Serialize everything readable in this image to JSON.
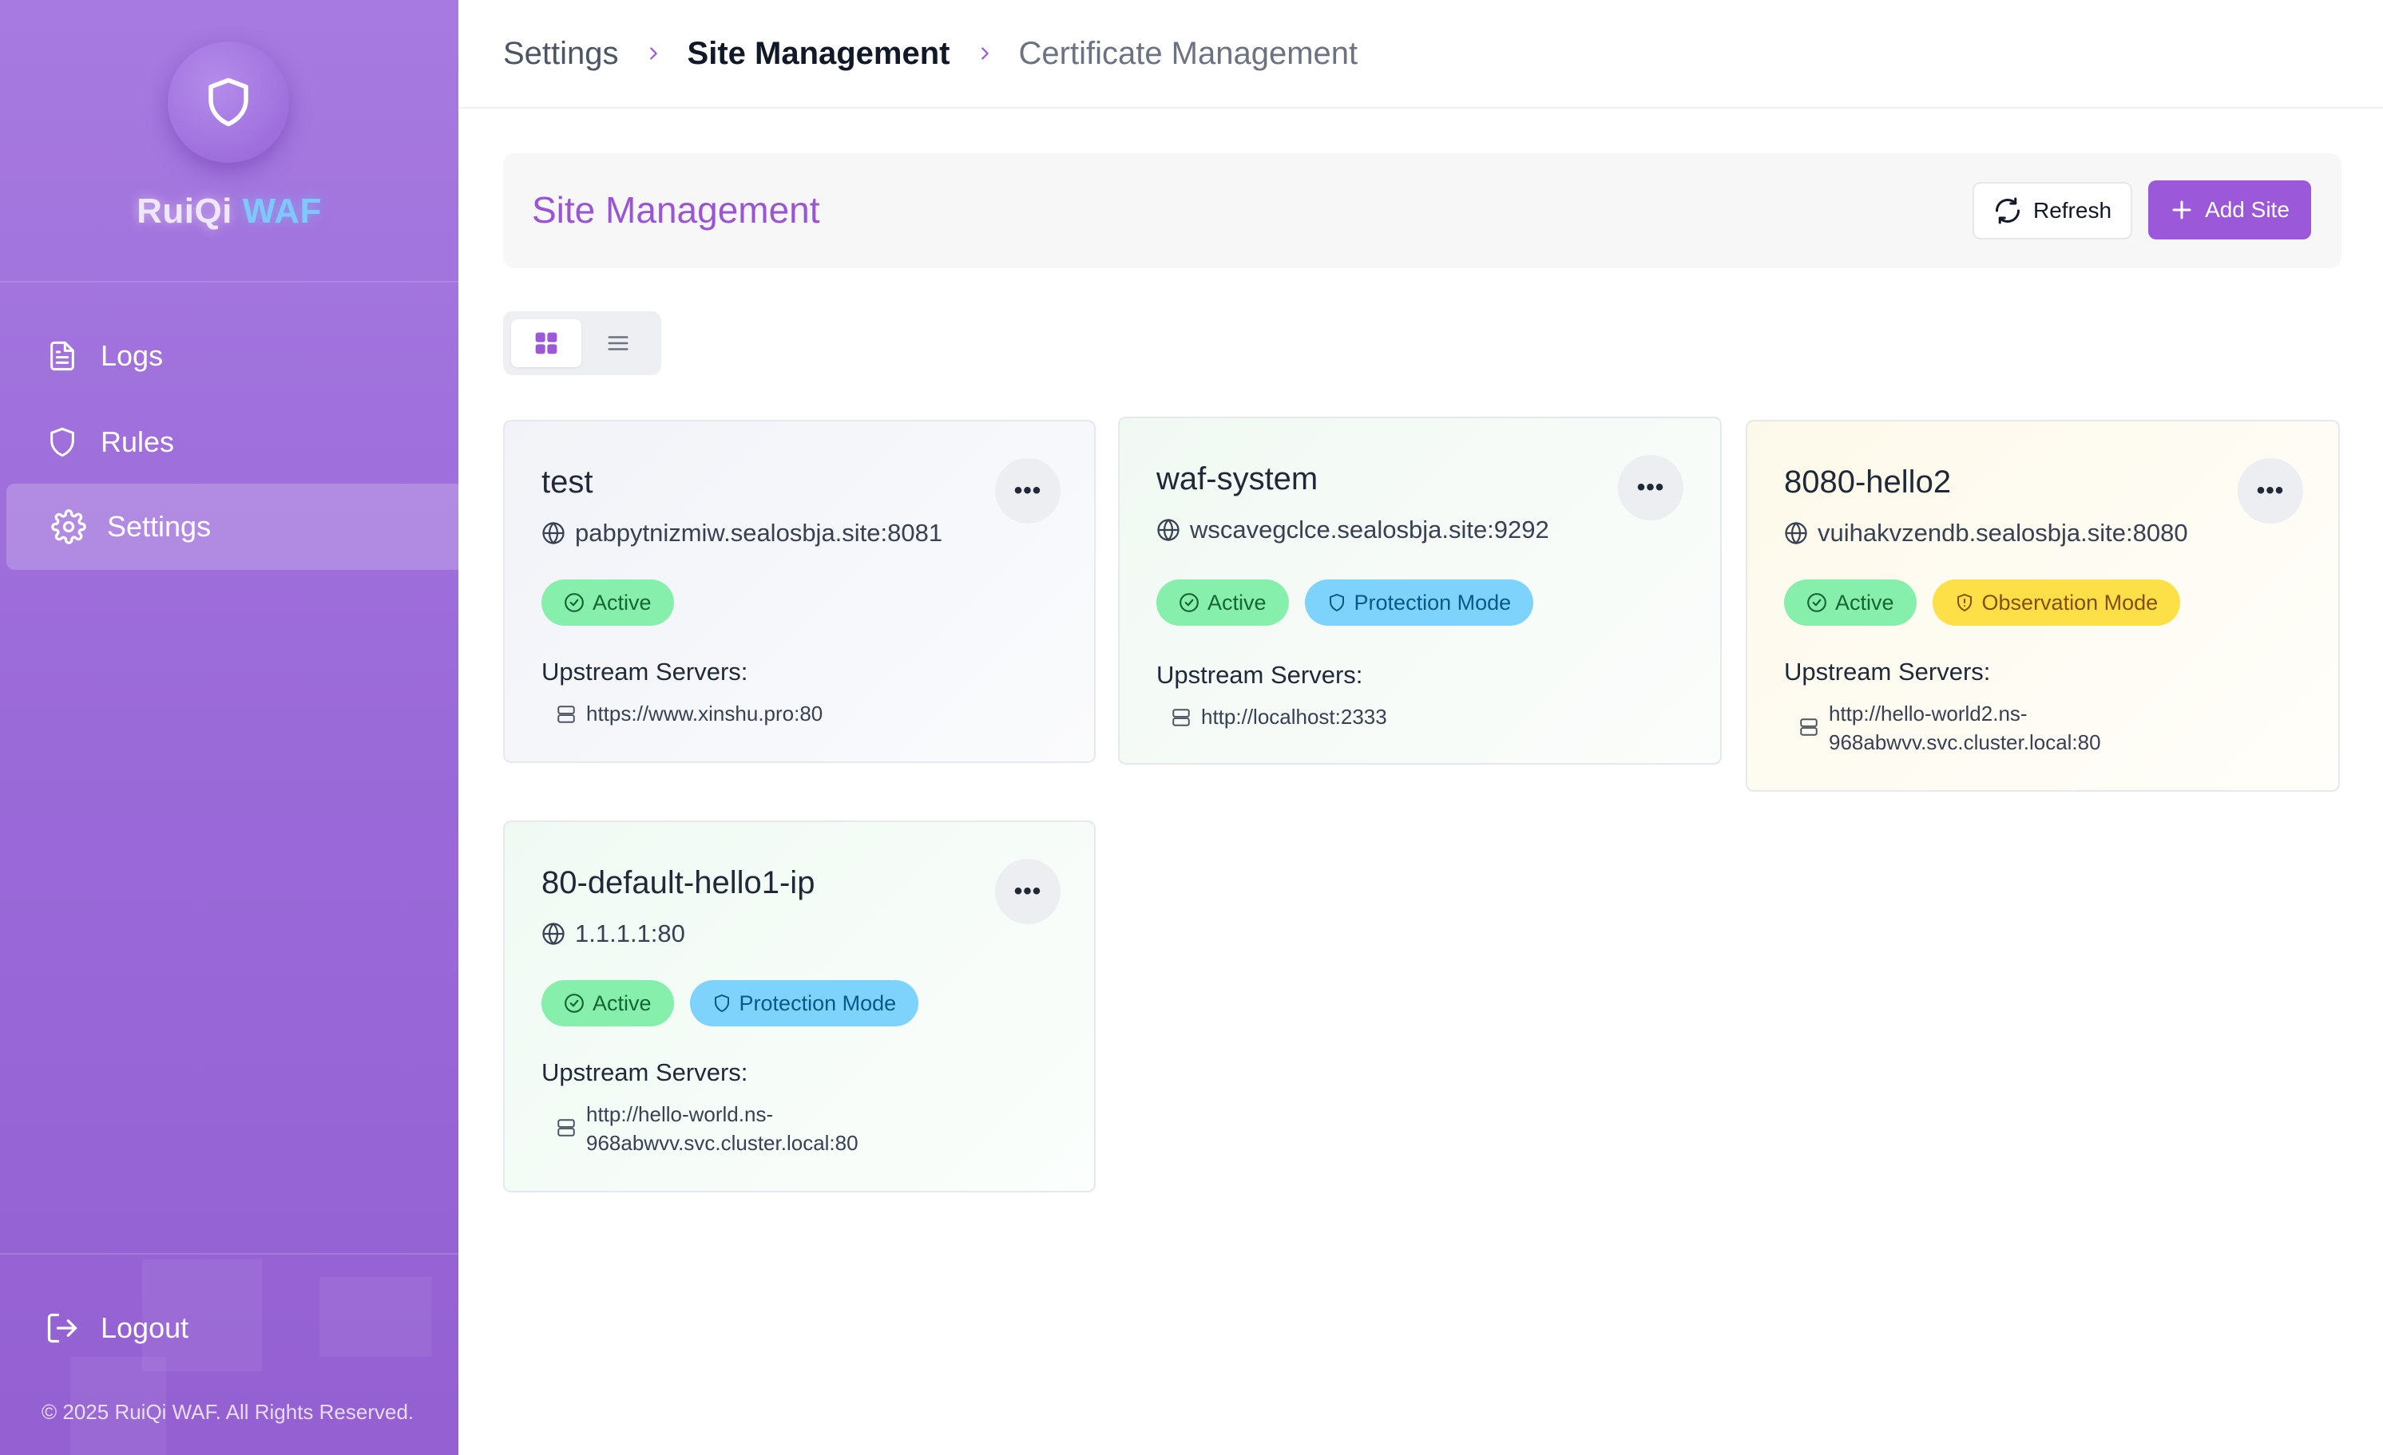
{
  "app": {
    "brand_part1": "RuiQi",
    "brand_part2": "WAF"
  },
  "sidebar": {
    "items": [
      {
        "label": "Logs",
        "icon": "file-text-icon"
      },
      {
        "label": "Rules",
        "icon": "shield-icon"
      },
      {
        "label": "Settings",
        "icon": "gear-icon",
        "active": true
      }
    ],
    "logout_label": "Logout",
    "copyright": "© 2025 RuiQi WAF. All Rights Reserved."
  },
  "breadcrumb": {
    "items": [
      "Settings",
      "Site Management",
      "Certificate Management"
    ]
  },
  "header": {
    "title": "Site Management",
    "refresh_label": "Refresh",
    "add_label": "Add Site"
  },
  "view_toggle": {
    "options": [
      "grid",
      "list"
    ],
    "selected": "grid"
  },
  "sites": [
    {
      "name": "test",
      "domain": "pabpytnizmiw.sealosbja.site:8081",
      "status": "Active",
      "mode": "",
      "upstream_label": "Upstream Servers:",
      "upstream_line1": "https://www.xinshu.pro:80",
      "upstream_line2": ""
    },
    {
      "name": "waf-system",
      "domain": "wscavegclce.sealosbja.site:9292",
      "status": "Active",
      "mode": "Protection Mode",
      "upstream_label": "Upstream Servers:",
      "upstream_line1": "http://localhost:2333",
      "upstream_line2": ""
    },
    {
      "name": "8080-hello2",
      "domain": "vuihakvzendb.sealosbja.site:8080",
      "status": "Active",
      "mode": "Observation Mode",
      "upstream_label": "Upstream Servers:",
      "upstream_line1": "http://hello-world2.ns-",
      "upstream_line2": "968abwvv.svc.cluster.local:80"
    },
    {
      "name": "80-default-hello1-ip",
      "domain": "1.1.1.1:80",
      "status": "Active",
      "mode": "Protection Mode",
      "upstream_label": "Upstream Servers:",
      "upstream_line1": "http://hello-world.ns-",
      "upstream_line2": "968abwvv.svc.cluster.local:80"
    }
  ],
  "colors": {
    "accent": "#9b59d9",
    "sidebar_top": "#a67ae0",
    "active_badge": "#86efac",
    "protection_badge": "#7dd3fc",
    "observation_badge": "#fde047"
  }
}
